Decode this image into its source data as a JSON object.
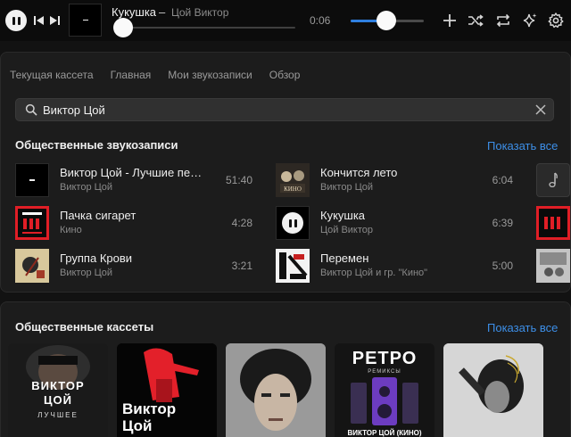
{
  "player": {
    "now_title": "Кукушка",
    "dash": "–",
    "now_artist": "Цой Виктор",
    "time_current": "0:06",
    "progress_fraction": 0.05,
    "volume_fraction": 0.5,
    "icons": [
      "pause-icon",
      "previous-icon",
      "next-icon",
      "plus-icon",
      "shuffle-icon",
      "repeat-icon",
      "sparkle-icon",
      "gear-icon"
    ],
    "accent": "#2f7fe0"
  },
  "tabs": [
    "Текущая кассета",
    "Главная",
    "Мои звукозаписи",
    "Обзор"
  ],
  "search": {
    "value": "Виктор Цой"
  },
  "public_tracks": {
    "title": "Общественные звукозаписи",
    "show_all": "Показать все",
    "columns": [
      [
        {
          "title": "Виктор Цой - Лучшие пес...",
          "artist": "Виктор Цой",
          "duration": "51:40"
        },
        {
          "title": "Пачка сигарет",
          "artist": "Кино",
          "duration": "4:28"
        },
        {
          "title": "Группа Крови",
          "artist": "Виктор Цой",
          "duration": "3:21"
        }
      ],
      [
        {
          "title": "Кончится лето",
          "artist": "Виктор Цой",
          "duration": "6:04"
        },
        {
          "title": "Кукушка",
          "artist": "Цой Виктор",
          "duration": "6:39"
        },
        {
          "title": "Перемен",
          "artist": "Виктор Цой и гр. \"Кино\"",
          "duration": "5:00"
        }
      ]
    ]
  },
  "cassettes": {
    "title": "Общественные кассеты",
    "show_all": "Показать все",
    "covers": [
      {
        "line1": "ВИКТОР",
        "line2": "ЦОЙ",
        "line3": "ЛУЧШЕЕ"
      },
      {
        "line1": "Виктор",
        "line2": "Цой"
      },
      {},
      {
        "line1": "РЕТРО",
        "line2": "РЕМИКСЫ",
        "line3": "ВИКТОР ЦОЙ (КИНО)"
      },
      {}
    ]
  }
}
